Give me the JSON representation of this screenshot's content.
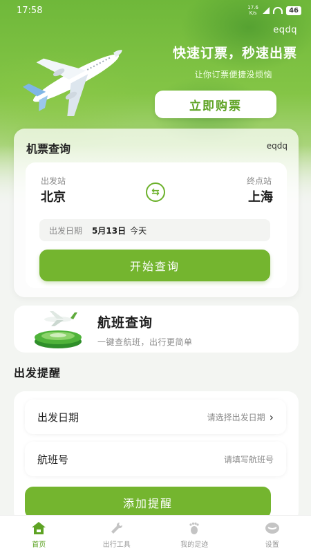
{
  "status_bar": {
    "time": "17:58",
    "net_speed": "17.6 K/s",
    "battery": "46"
  },
  "hero": {
    "brand": "eqdq",
    "slogan": "快速订票，秒速出票",
    "sub_slogan": "让你订票便捷没烦恼",
    "buy_button": "立即购票"
  },
  "ticket_query": {
    "title": "机票查询",
    "tag": "eqdq",
    "from_label": "出发站",
    "from_city": "北京",
    "to_label": "终点站",
    "to_city": "上海",
    "date_label": "出发日期",
    "date_value": "5月13日",
    "date_today": "今天",
    "query_button": "开始查询"
  },
  "flight_query": {
    "title": "航班查询",
    "subtitle": "一键查航班，出行更简单"
  },
  "reminder": {
    "section_title": "出发提醒",
    "date_label": "出发日期",
    "date_placeholder": "请选择出发日期",
    "flight_label": "航班号",
    "flight_placeholder": "请填写航班号",
    "add_button": "添加提醒"
  },
  "tabbar": {
    "tabs": [
      {
        "label": "首页",
        "icon": "home-icon",
        "active": true
      },
      {
        "label": "出行工具",
        "icon": "wrench-icon",
        "active": false
      },
      {
        "label": "我的足迹",
        "icon": "footprint-icon",
        "active": false
      },
      {
        "label": "设置",
        "icon": "settings-icon",
        "active": false
      }
    ]
  },
  "colors": {
    "accent": "#74b52f",
    "accent_text": "#5ea324"
  }
}
